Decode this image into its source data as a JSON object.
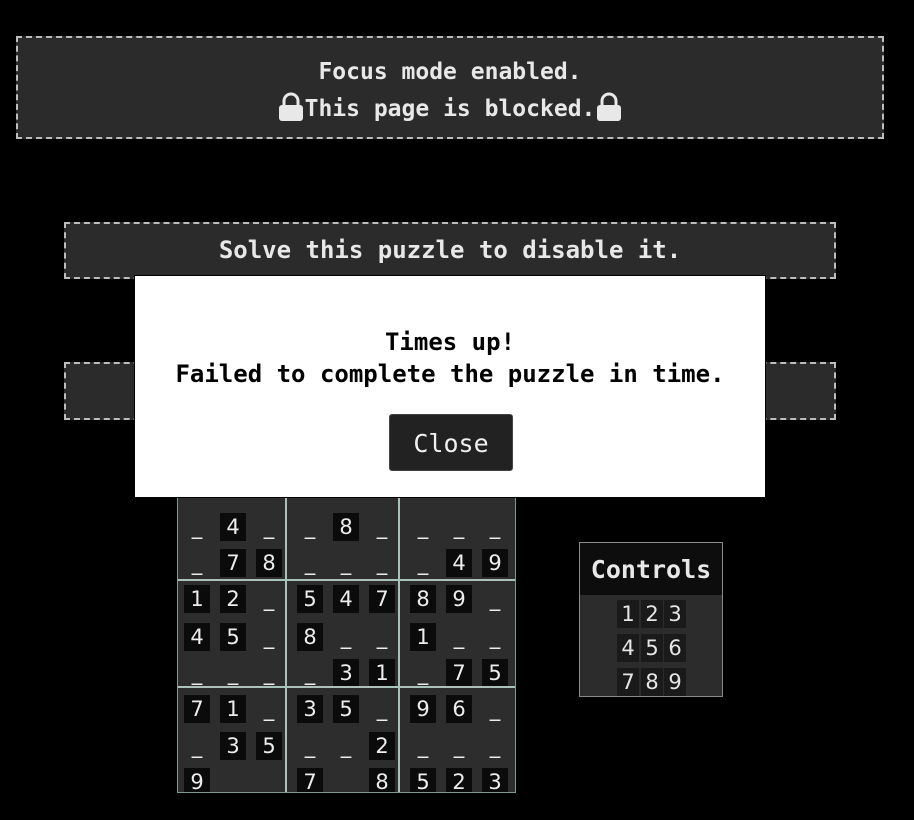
{
  "focus_banner": {
    "line1": "Focus mode enabled.",
    "line2": "This page is blocked."
  },
  "puzzle_banner": {
    "text": "Solve this puzzle to disable it."
  },
  "modal": {
    "line1": "Times up!",
    "line2": "Failed to complete the puzzle in time.",
    "close_label": "Close"
  },
  "board": {
    "rows": [
      [
        "_",
        "_",
        "_",
        "_",
        "_",
        "_",
        "_",
        "_",
        "_"
      ],
      [
        "_",
        "4",
        "_",
        "_",
        "8",
        "_",
        "_",
        "_",
        "_"
      ],
      [
        "_",
        "7",
        "8",
        "_",
        "_",
        "_",
        "_",
        "4",
        "9"
      ],
      [
        "1",
        "2",
        "_",
        "5",
        "4",
        "7",
        "8",
        "9",
        "_"
      ],
      [
        "4",
        "5",
        "_",
        "8",
        "_",
        "_",
        "1",
        "_",
        "_"
      ],
      [
        "_",
        "_",
        "_",
        "_",
        "3",
        "1",
        "_",
        "7",
        "5"
      ],
      [
        "7",
        "1",
        "_",
        "3",
        "5",
        "_",
        "9",
        "6",
        "_"
      ],
      [
        "_",
        "3",
        "5",
        "_",
        "_",
        "2",
        "_",
        "_",
        "_"
      ],
      [
        "9",
        "_",
        "_",
        "7",
        "_",
        "8",
        "5",
        "2",
        "3"
      ]
    ]
  },
  "controls": {
    "title": "Controls",
    "keys": [
      [
        "1",
        "2",
        "3"
      ],
      [
        "4",
        "5",
        "6"
      ],
      [
        "7",
        "8",
        "9"
      ]
    ]
  }
}
